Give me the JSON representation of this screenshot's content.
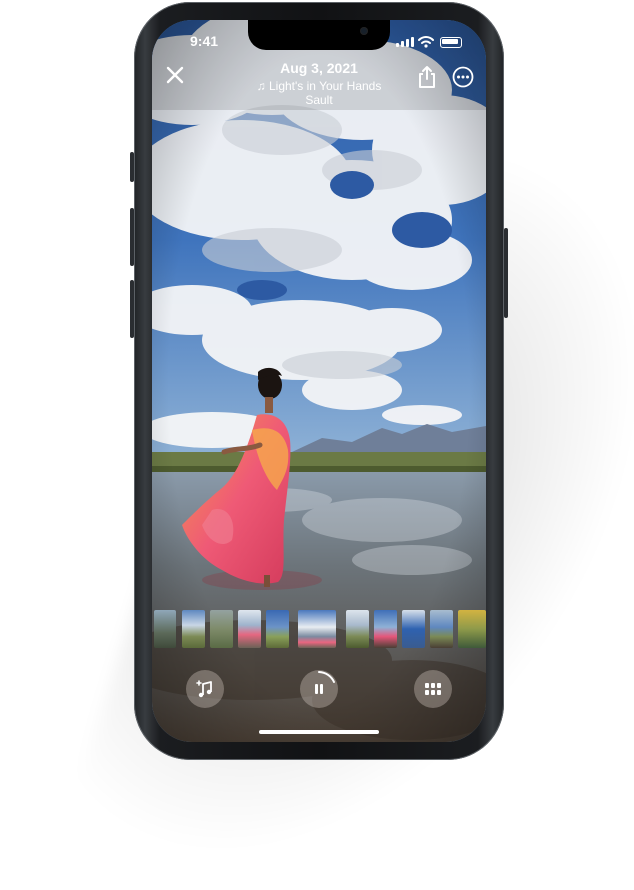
{
  "status_bar": {
    "time": "9:41"
  },
  "header": {
    "date": "Aug 3, 2021",
    "song_title": "♫ Light's in Your Hands",
    "artist": "Sault"
  },
  "icons": {
    "close": "close-icon",
    "share": "share-icon",
    "more": "more-icon",
    "music": "music-add-icon",
    "pause": "pause-icon",
    "grid": "grid-icon"
  },
  "colors": {
    "frame": "#111214",
    "sky": "#3c6db3",
    "dress": "#ef5a76",
    "water": "#6b6256"
  },
  "filmstrip": {
    "thumbnails": [
      {
        "label": "thumb-1"
      },
      {
        "label": "thumb-2"
      },
      {
        "label": "thumb-3"
      },
      {
        "label": "thumb-4"
      },
      {
        "label": "thumb-5"
      },
      {
        "label": "thumb-6"
      },
      {
        "label": "thumb-7"
      },
      {
        "label": "thumb-8"
      },
      {
        "label": "thumb-9"
      },
      {
        "label": "thumb-10"
      },
      {
        "label": "thumb-11"
      }
    ]
  }
}
